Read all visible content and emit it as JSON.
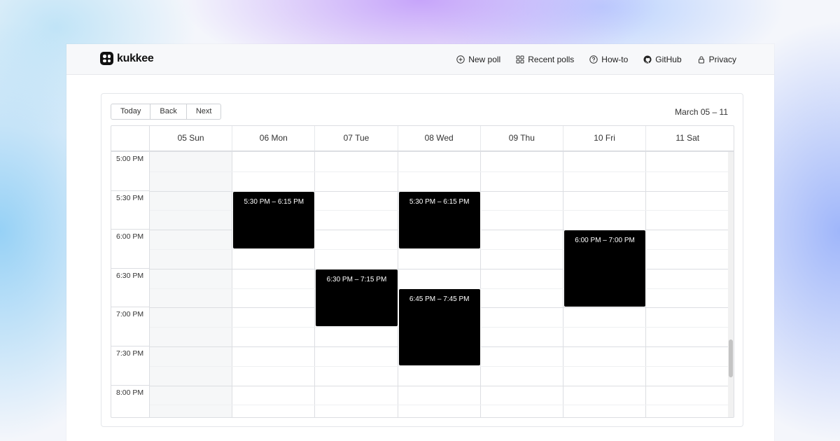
{
  "brand": {
    "name": "kukkee"
  },
  "nav": [
    {
      "label": "New poll",
      "icon": "plus-circle-icon"
    },
    {
      "label": "Recent polls",
      "icon": "grid-icon"
    },
    {
      "label": "How-to",
      "icon": "question-circle-icon"
    },
    {
      "label": "GitHub",
      "icon": "github-icon"
    },
    {
      "label": "Privacy",
      "icon": "lock-icon"
    }
  ],
  "toolbar": {
    "today": "Today",
    "back": "Back",
    "next": "Next",
    "range": "March 05 – 11"
  },
  "days": [
    "05 Sun",
    "06 Mon",
    "07 Tue",
    "08 Wed",
    "09 Thu",
    "10 Fri",
    "11 Sat"
  ],
  "times": [
    "5:00 PM",
    "5:30 PM",
    "6:00 PM",
    "6:30 PM",
    "7:00 PM",
    "7:30 PM",
    "8:00 PM"
  ],
  "events": [
    {
      "label": "5:30 PM – 6:15 PM",
      "day": 1,
      "start": "5:30 PM",
      "end": "6:15 PM"
    },
    {
      "label": "5:30 PM – 6:15 PM",
      "day": 3,
      "start": "5:30 PM",
      "end": "6:15 PM"
    },
    {
      "label": "6:00 PM – 7:00 PM",
      "day": 5,
      "start": "6:00 PM",
      "end": "7:00 PM"
    },
    {
      "label": "6:30 PM – 7:15 PM",
      "day": 2,
      "start": "6:30 PM",
      "end": "7:15 PM"
    },
    {
      "label": "6:45 PM – 7:45 PM",
      "day": 3,
      "start": "6:45 PM",
      "end": "7:45 PM"
    }
  ],
  "colors": {
    "event": "#000000",
    "past_day": "#f6f7f8",
    "nav_bg": "#f7f8fa"
  }
}
